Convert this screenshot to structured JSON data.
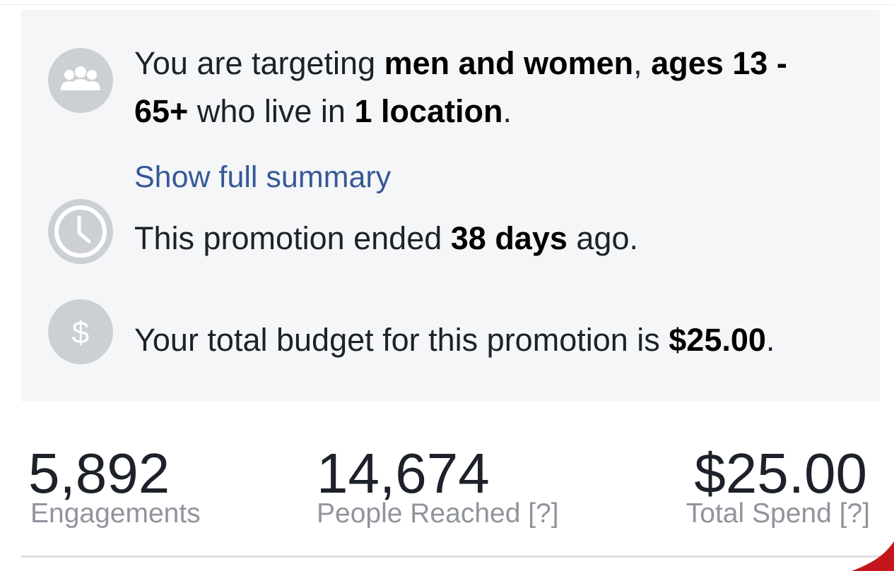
{
  "summary": {
    "targeting": {
      "icon": "people-icon",
      "prefix": "You are targeting ",
      "gender": "men and women",
      "comma": ", ",
      "ages_line1": "ages 13 -",
      "ages_line2": "65+",
      "middle": " who live in ",
      "location": "1 location",
      "end": "."
    },
    "show_full_summary": "Show full summary",
    "schedule": {
      "icon": "clock-icon",
      "prefix": "This promotion ended ",
      "duration": "38 days",
      "suffix": " ago."
    },
    "budget": {
      "icon": "dollar-icon",
      "prefix": "Your total budget for this promotion is ",
      "amount": "$25.00",
      "suffix": "."
    }
  },
  "stats": {
    "engagements": {
      "value": "5,892",
      "label": "Engagements"
    },
    "reach": {
      "value": "14,674",
      "label": "People Reached",
      "help": "[?]"
    },
    "spend": {
      "value": "$25.00",
      "label": "Total Spend",
      "help": "[?]"
    }
  },
  "colors": {
    "panel_bg": "#f5f6f7",
    "icon_bg": "#ccd0d5",
    "link": "#365899",
    "muted": "#90949c",
    "accent_corner": "#c4161c"
  }
}
